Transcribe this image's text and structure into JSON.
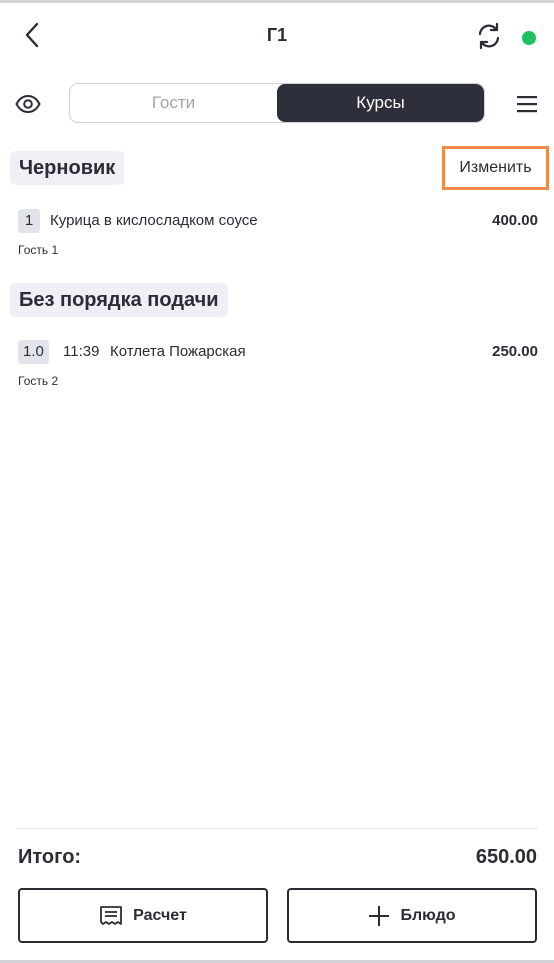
{
  "header": {
    "title": "Г1",
    "status_color": "#1fc060"
  },
  "tabs": {
    "guests_label": "Гости",
    "courses_label": "Курсы",
    "active": "Курсы"
  },
  "sections": {
    "draft": {
      "title": "Черновик",
      "edit_label": "Изменить",
      "items": [
        {
          "badge": "1",
          "name": "Курица в кислосладком соусе",
          "price": "400.00",
          "guest": "Гость 1"
        }
      ]
    },
    "unordered": {
      "title": "Без порядка подачи",
      "items": [
        {
          "badge": "1.0",
          "time": "11:39",
          "name": "Котлета Пожарская",
          "price": "250.00",
          "guest": "Гость 2"
        }
      ]
    }
  },
  "footer": {
    "total_label": "Итого:",
    "total_value": "650.00",
    "pay_label": "Расчет",
    "add_label": "Блюдо"
  },
  "icons": {
    "back": "chevron-left-icon",
    "sync": "sync-icon",
    "eye": "eye-icon",
    "menu": "hamburger-menu-icon",
    "receipt": "receipt-icon",
    "plus": "plus-icon"
  }
}
